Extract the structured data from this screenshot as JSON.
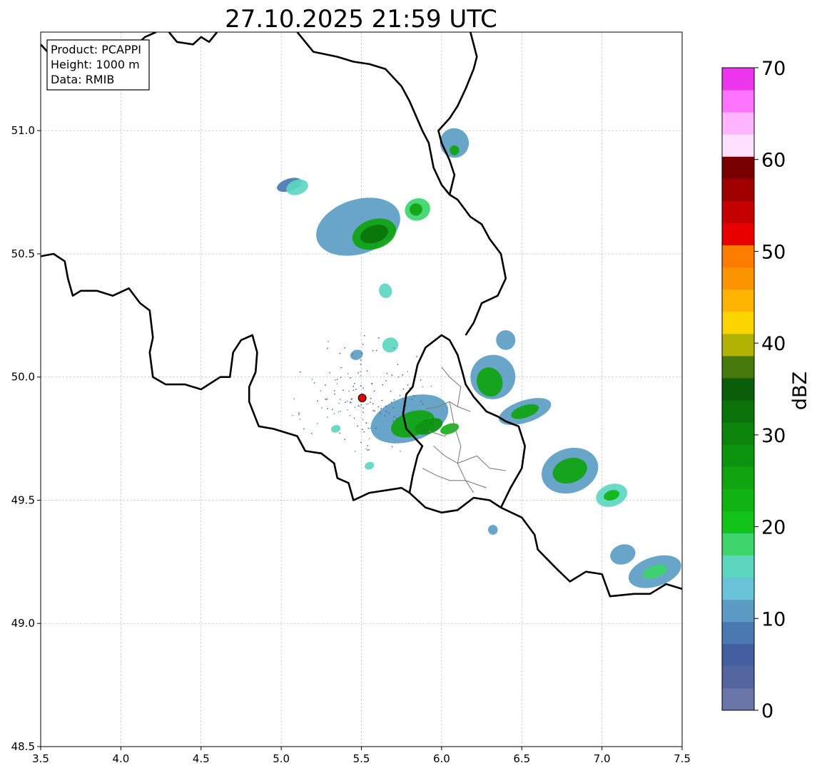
{
  "title": "27.10.2025 21:59 UTC",
  "info_box": {
    "product": "Product: PCAPPI",
    "height": "Height: 1000 m",
    "data": "Data: RMIB"
  },
  "map": {
    "lon_range": [
      3.5,
      7.5
    ],
    "lat_range": [
      48.5,
      51.4
    ],
    "x_ticks": [
      "3.5",
      "4.0",
      "4.5",
      "5.0",
      "5.5",
      "6.0",
      "6.5",
      "7.0",
      "7.5"
    ],
    "y_ticks": [
      "48.5",
      "49.0",
      "49.5",
      "50.0",
      "50.5",
      "51.0"
    ],
    "grid": true,
    "radar_site": {
      "lon": 5.505,
      "lat": 49.915,
      "color": "#e00000"
    }
  },
  "colorbar": {
    "label": "dBZ",
    "range": [
      0,
      70
    ],
    "tick_labels": [
      "0",
      "10",
      "20",
      "30",
      "40",
      "50",
      "60",
      "70"
    ],
    "colors": [
      "#6a76a8",
      "#5466a0",
      "#435f9f",
      "#4a78b0",
      "#5c9cc4",
      "#68c2d8",
      "#5dd6c0",
      "#3dd46c",
      "#12c41a",
      "#10b412",
      "#0fa410",
      "#0d940e",
      "#0c840c",
      "#0a740a",
      "#0a5e0a",
      "#457a0a",
      "#b2b204",
      "#fcd400",
      "#fcb400",
      "#fc9400",
      "#fc7c00",
      "#e80000",
      "#c40000",
      "#a00000",
      "#780000",
      "#ffe0ff",
      "#ffb4ff",
      "#ff74ff",
      "#ee36ee"
    ]
  },
  "echoes": [
    {
      "lon": 5.05,
      "lat": 50.78,
      "rx": 0.08,
      "ry": 0.025,
      "level": 8
    },
    {
      "lon": 5.1,
      "lat": 50.77,
      "rx": 0.07,
      "ry": 0.03,
      "level": 15
    },
    {
      "lon": 5.48,
      "lat": 50.61,
      "rx": 0.27,
      "ry": 0.11,
      "level": 10
    },
    {
      "lon": 5.58,
      "lat": 50.58,
      "rx": 0.14,
      "ry": 0.06,
      "level": 25
    },
    {
      "lon": 5.58,
      "lat": 50.58,
      "rx": 0.09,
      "ry": 0.035,
      "level": 32
    },
    {
      "lon": 5.85,
      "lat": 50.68,
      "rx": 0.08,
      "ry": 0.045,
      "level": 18
    },
    {
      "lon": 5.84,
      "lat": 50.68,
      "rx": 0.04,
      "ry": 0.025,
      "level": 25
    },
    {
      "lon": 5.65,
      "lat": 50.35,
      "rx": 0.04,
      "ry": 0.03,
      "level": 15
    },
    {
      "lon": 6.08,
      "lat": 50.95,
      "rx": 0.09,
      "ry": 0.06,
      "level": 10
    },
    {
      "lon": 6.08,
      "lat": 50.92,
      "rx": 0.03,
      "ry": 0.02,
      "level": 25
    },
    {
      "lon": 5.47,
      "lat": 50.09,
      "rx": 0.04,
      "ry": 0.02,
      "level": 12
    },
    {
      "lon": 5.68,
      "lat": 50.13,
      "rx": 0.05,
      "ry": 0.03,
      "level": 15
    },
    {
      "lon": 5.8,
      "lat": 49.83,
      "rx": 0.25,
      "ry": 0.09,
      "level": 12
    },
    {
      "lon": 5.82,
      "lat": 49.81,
      "rx": 0.14,
      "ry": 0.05,
      "level": 25
    },
    {
      "lon": 5.92,
      "lat": 49.8,
      "rx": 0.09,
      "ry": 0.03,
      "level": 28
    },
    {
      "lon": 6.05,
      "lat": 49.79,
      "rx": 0.06,
      "ry": 0.02,
      "level": 22
    },
    {
      "lon": 5.34,
      "lat": 49.79,
      "rx": 0.03,
      "ry": 0.015,
      "level": 15
    },
    {
      "lon": 5.55,
      "lat": 49.64,
      "rx": 0.03,
      "ry": 0.015,
      "level": 15
    },
    {
      "lon": 6.32,
      "lat": 50.0,
      "rx": 0.14,
      "ry": 0.09,
      "level": 12
    },
    {
      "lon": 6.3,
      "lat": 49.98,
      "rx": 0.08,
      "ry": 0.06,
      "level": 25
    },
    {
      "lon": 6.4,
      "lat": 50.15,
      "rx": 0.06,
      "ry": 0.04,
      "level": 10
    },
    {
      "lon": 6.52,
      "lat": 49.86,
      "rx": 0.17,
      "ry": 0.045,
      "level": 12
    },
    {
      "lon": 6.52,
      "lat": 49.86,
      "rx": 0.09,
      "ry": 0.025,
      "level": 25
    },
    {
      "lon": 6.8,
      "lat": 49.62,
      "rx": 0.18,
      "ry": 0.09,
      "level": 12
    },
    {
      "lon": 6.8,
      "lat": 49.62,
      "rx": 0.11,
      "ry": 0.05,
      "level": 25
    },
    {
      "lon": 7.06,
      "lat": 49.52,
      "rx": 0.1,
      "ry": 0.045,
      "level": 15
    },
    {
      "lon": 7.06,
      "lat": 49.52,
      "rx": 0.05,
      "ry": 0.02,
      "level": 22
    },
    {
      "lon": 6.32,
      "lat": 49.38,
      "rx": 0.03,
      "ry": 0.02,
      "level": 12
    },
    {
      "lon": 7.13,
      "lat": 49.28,
      "rx": 0.08,
      "ry": 0.04,
      "level": 12
    },
    {
      "lon": 7.33,
      "lat": 49.21,
      "rx": 0.17,
      "ry": 0.06,
      "level": 12
    },
    {
      "lon": 7.33,
      "lat": 49.21,
      "rx": 0.08,
      "ry": 0.025,
      "level": 18
    }
  ],
  "borders": [
    [
      [
        3.5,
        50.49
      ],
      [
        3.58,
        50.5
      ],
      [
        3.65,
        50.47
      ],
      [
        3.67,
        50.4
      ],
      [
        3.7,
        50.33
      ],
      [
        3.75,
        50.35
      ],
      [
        3.85,
        50.35
      ],
      [
        3.95,
        50.33
      ],
      [
        4.05,
        50.36
      ],
      [
        4.12,
        50.3
      ],
      [
        4.18,
        50.27
      ],
      [
        4.2,
        50.16
      ],
      [
        4.18,
        50.1
      ],
      [
        4.2,
        50.0
      ],
      [
        4.28,
        49.97
      ],
      [
        4.4,
        49.97
      ],
      [
        4.5,
        49.95
      ],
      [
        4.62,
        50.0
      ],
      [
        4.68,
        50.0
      ],
      [
        4.7,
        50.1
      ],
      [
        4.75,
        50.15
      ],
      [
        4.82,
        50.17
      ],
      [
        4.85,
        50.1
      ],
      [
        4.84,
        50.02
      ],
      [
        4.8,
        49.96
      ],
      [
        4.8,
        49.9
      ],
      [
        4.86,
        49.8
      ],
      [
        4.95,
        49.79
      ],
      [
        5.1,
        49.76
      ],
      [
        5.15,
        49.7
      ],
      [
        5.25,
        49.69
      ],
      [
        5.33,
        49.65
      ],
      [
        5.35,
        49.59
      ],
      [
        5.42,
        49.57
      ],
      [
        5.45,
        49.5
      ],
      [
        5.55,
        49.53
      ],
      [
        5.65,
        49.54
      ],
      [
        5.75,
        49.55
      ],
      [
        5.8,
        49.53
      ]
    ],
    [
      [
        5.8,
        49.53
      ],
      [
        5.82,
        49.6
      ],
      [
        5.85,
        49.68
      ],
      [
        5.88,
        49.72
      ],
      [
        5.78,
        49.79
      ],
      [
        5.76,
        49.85
      ],
      [
        5.78,
        49.93
      ],
      [
        5.82,
        49.96
      ],
      [
        5.85,
        50.05
      ],
      [
        5.9,
        50.12
      ],
      [
        6.0,
        50.17
      ],
      [
        6.05,
        50.15
      ],
      [
        6.1,
        50.09
      ],
      [
        6.13,
        50.02
      ],
      [
        6.15,
        49.97
      ],
      [
        6.2,
        49.92
      ],
      [
        6.28,
        49.86
      ],
      [
        6.35,
        49.84
      ],
      [
        6.4,
        49.82
      ],
      [
        6.48,
        49.8
      ],
      [
        6.52,
        49.72
      ],
      [
        6.5,
        49.63
      ],
      [
        6.43,
        49.55
      ],
      [
        6.37,
        49.47
      ]
    ],
    [
      [
        5.8,
        49.53
      ],
      [
        5.9,
        49.47
      ],
      [
        6.0,
        49.45
      ],
      [
        6.1,
        49.46
      ],
      [
        6.2,
        49.51
      ],
      [
        6.3,
        49.5
      ],
      [
        6.37,
        49.47
      ]
    ],
    [
      [
        6.37,
        49.47
      ],
      [
        6.5,
        49.43
      ],
      [
        6.58,
        49.36
      ],
      [
        6.6,
        49.3
      ],
      [
        6.72,
        49.22
      ],
      [
        6.8,
        49.17
      ],
      [
        6.9,
        49.21
      ],
      [
        7.0,
        49.2
      ],
      [
        7.05,
        49.11
      ],
      [
        7.2,
        49.12
      ],
      [
        7.3,
        49.12
      ],
      [
        7.4,
        49.16
      ],
      [
        7.5,
        49.14
      ]
    ],
    [
      [
        6.15,
        50.17
      ],
      [
        6.2,
        50.22
      ],
      [
        6.25,
        50.3
      ],
      [
        6.35,
        50.33
      ],
      [
        6.4,
        50.4
      ],
      [
        6.37,
        50.5
      ],
      [
        6.3,
        50.56
      ],
      [
        6.25,
        50.62
      ],
      [
        6.18,
        50.65
      ],
      [
        6.1,
        50.72
      ],
      [
        6.05,
        50.74
      ],
      [
        6.0,
        50.78
      ],
      [
        5.95,
        50.85
      ],
      [
        5.92,
        50.95
      ],
      [
        5.88,
        51.0
      ],
      [
        5.8,
        51.12
      ],
      [
        5.75,
        51.18
      ],
      [
        5.65,
        51.25
      ],
      [
        5.55,
        51.27
      ],
      [
        5.45,
        51.28
      ],
      [
        5.35,
        51.3
      ],
      [
        5.2,
        51.32
      ],
      [
        5.1,
        51.4
      ]
    ],
    [
      [
        6.05,
        50.74
      ],
      [
        6.08,
        50.82
      ],
      [
        6.05,
        50.88
      ],
      [
        6.0,
        50.95
      ],
      [
        5.98,
        51.0
      ],
      [
        6.05,
        51.05
      ],
      [
        6.1,
        51.1
      ],
      [
        6.15,
        51.17
      ],
      [
        6.2,
        51.25
      ],
      [
        6.22,
        51.3
      ],
      [
        6.18,
        51.4
      ]
    ],
    [
      [
        4.3,
        51.4
      ],
      [
        4.35,
        51.36
      ],
      [
        4.45,
        51.35
      ],
      [
        4.5,
        51.38
      ],
      [
        4.55,
        51.36
      ],
      [
        4.6,
        51.4
      ]
    ],
    [
      [
        3.5,
        51.35
      ],
      [
        3.6,
        51.28
      ],
      [
        3.75,
        51.25
      ],
      [
        3.85,
        51.28
      ],
      [
        3.95,
        51.25
      ],
      [
        4.05,
        51.32
      ],
      [
        4.15,
        51.38
      ],
      [
        4.22,
        51.4
      ]
    ]
  ],
  "subregions": [
    [
      [
        5.9,
        49.87
      ],
      [
        5.98,
        49.88
      ],
      [
        6.05,
        49.9
      ],
      [
        6.1,
        49.88
      ],
      [
        6.18,
        49.86
      ]
    ],
    [
      [
        6.05,
        49.9
      ],
      [
        6.08,
        49.8
      ],
      [
        6.12,
        49.72
      ],
      [
        6.1,
        49.65
      ],
      [
        6.15,
        49.58
      ],
      [
        6.2,
        49.53
      ]
    ],
    [
      [
        5.95,
        49.72
      ],
      [
        6.02,
        49.68
      ],
      [
        6.1,
        49.65
      ],
      [
        6.22,
        49.68
      ],
      [
        6.3,
        49.63
      ],
      [
        6.4,
        49.62
      ]
    ],
    [
      [
        5.88,
        49.63
      ],
      [
        5.97,
        49.6
      ],
      [
        6.05,
        49.58
      ],
      [
        6.15,
        49.58
      ],
      [
        6.28,
        49.55
      ]
    ],
    [
      [
        5.92,
        49.78
      ],
      [
        6.02,
        49.76
      ],
      [
        6.08,
        49.8
      ]
    ],
    [
      [
        6.1,
        49.88
      ],
      [
        6.12,
        49.96
      ],
      [
        6.05,
        50.0
      ],
      [
        6.0,
        50.04
      ]
    ]
  ]
}
